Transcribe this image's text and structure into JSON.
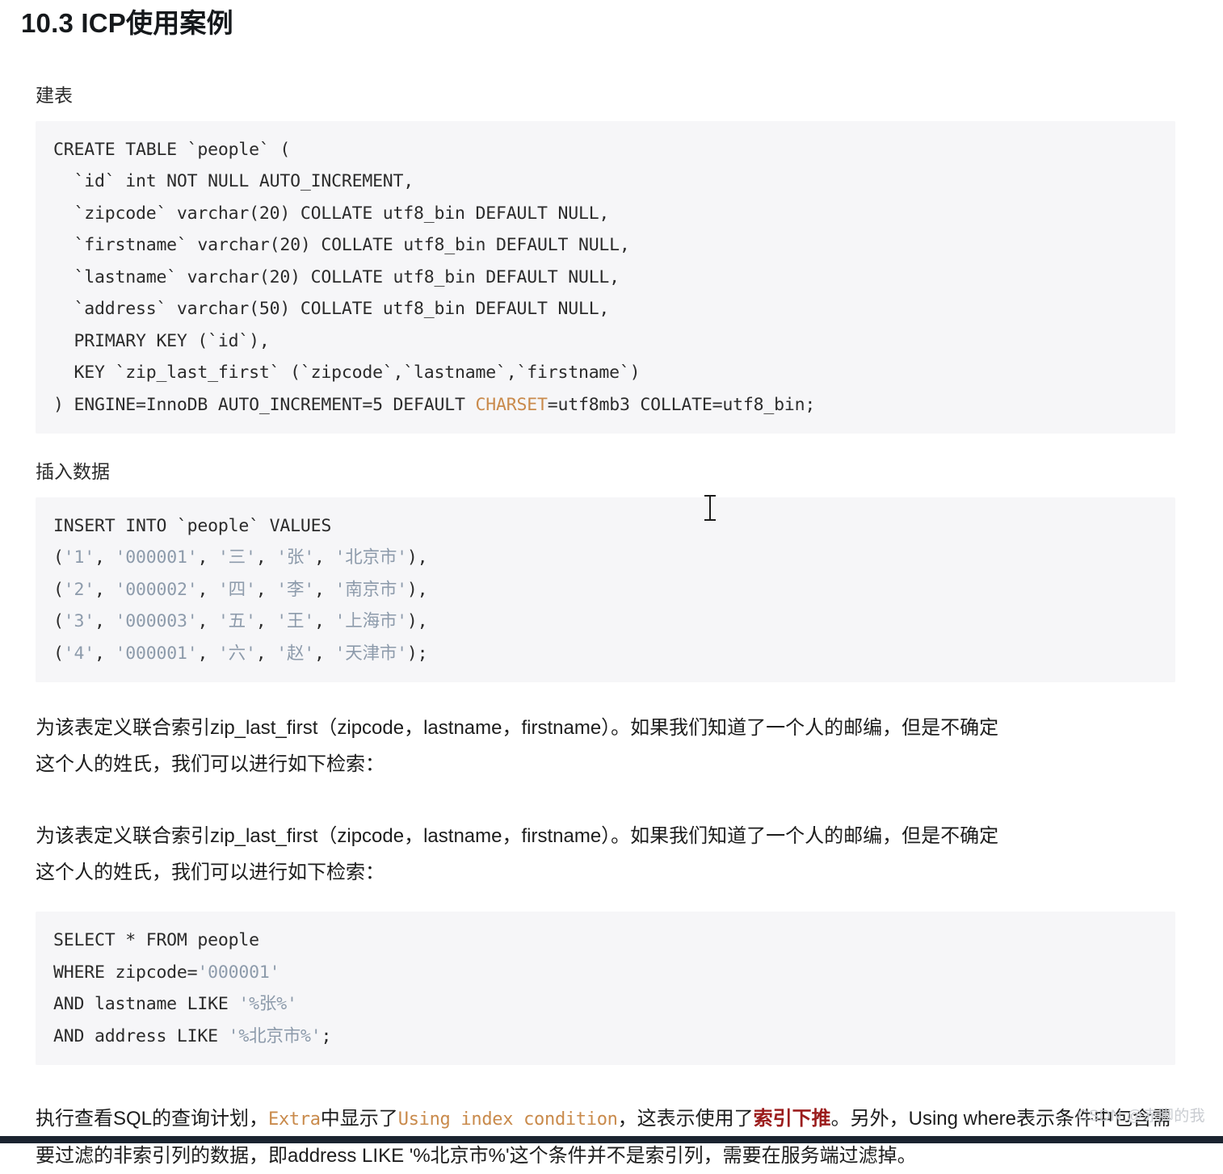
{
  "heading": "10.3 ICP使用案例",
  "labels": {
    "build_table": "建表",
    "insert_data": "插入数据"
  },
  "code_blocks": {
    "create_table": {
      "lines": [
        "CREATE TABLE `people` (",
        "  `id` int NOT NULL AUTO_INCREMENT,",
        "  `zipcode` varchar(20) COLLATE utf8_bin DEFAULT NULL,",
        "  `firstname` varchar(20) COLLATE utf8_bin DEFAULT NULL,",
        "  `lastname` varchar(20) COLLATE utf8_bin DEFAULT NULL,",
        "  `address` varchar(50) COLLATE utf8_bin DEFAULT NULL,",
        "  PRIMARY KEY (`id`),",
        "  KEY `zip_last_first` (`zipcode`,`lastname`,`firstname`)",
        ") ENGINE=InnoDB AUTO_INCREMENT=5 DEFAULT CHARSET=utf8mb3 COLLATE=utf8_bin;"
      ],
      "highlighted_keyword": "CHARSET",
      "keyword_color": "#c98a4b"
    },
    "insert_values": {
      "header": "INSERT INTO `people` VALUES",
      "rows": [
        {
          "id": "'1'",
          "zipcode": "'000001'",
          "firstname": "'三'",
          "lastname": "'张'",
          "address": "'北京市'",
          "terminator": "),"
        },
        {
          "id": "'2'",
          "zipcode": "'000002'",
          "firstname": "'四'",
          "lastname": "'李'",
          "address": "'南京市'",
          "terminator": "),"
        },
        {
          "id": "'3'",
          "zipcode": "'000003'",
          "firstname": "'五'",
          "lastname": "'王'",
          "address": "'上海市'",
          "terminator": "),"
        },
        {
          "id": "'4'",
          "zipcode": "'000001'",
          "firstname": "'六'",
          "lastname": "'赵'",
          "address": "'天津市'",
          "terminator": ");"
        }
      ],
      "string_color": "#8d9bab"
    },
    "select_query": {
      "lines": [
        "SELECT * FROM people",
        "WHERE zipcode='000001'",
        "AND lastname LIKE '%张%'",
        "AND address LIKE '%北京市%';"
      ],
      "string_literals": [
        "'000001'",
        "'%张%'",
        "'%北京市%'"
      ]
    }
  },
  "paragraphs": {
    "p1_line1": "为该表定义联合索引zip_last_first（zipcode，lastname，firstname）。如果我们知道了一个人的邮编，但是不确定",
    "p1_line2": "这个人的姓氏，我们可以进行如下检索：",
    "p2_line1": "为该表定义联合索引zip_last_first（zipcode，lastname，firstname）。如果我们知道了一个人的邮编，但是不确定",
    "p2_line2": "这个人的姓氏，我们可以进行如下检索：",
    "p3": {
      "seg1": "执行查看SQL的查询计划，",
      "code1": "Extra",
      "seg2": "中显示了",
      "code2": "Using index condition",
      "seg3": "，这表示使用了",
      "emphasis": "索引下推",
      "seg4": "。另外，Using where表示条件中包含需要过滤的非索引列的数据，即address LIKE '%北京市%'这个条件并不是索引列，需要在服务端过滤掉。"
    }
  },
  "watermark": "CSDN @赤脚的我",
  "colors": {
    "page_background": "#ffffff",
    "code_background": "#f6f6f8",
    "body_text": "#1d1d1d",
    "code_text": "#2b2b2b",
    "string_literal": "#8d9bab",
    "keyword_accent": "#c98a4b",
    "emphasis_red": "#9b1c1c",
    "watermark": "#c9ccd1",
    "bottom_bar": "#1b2430"
  }
}
